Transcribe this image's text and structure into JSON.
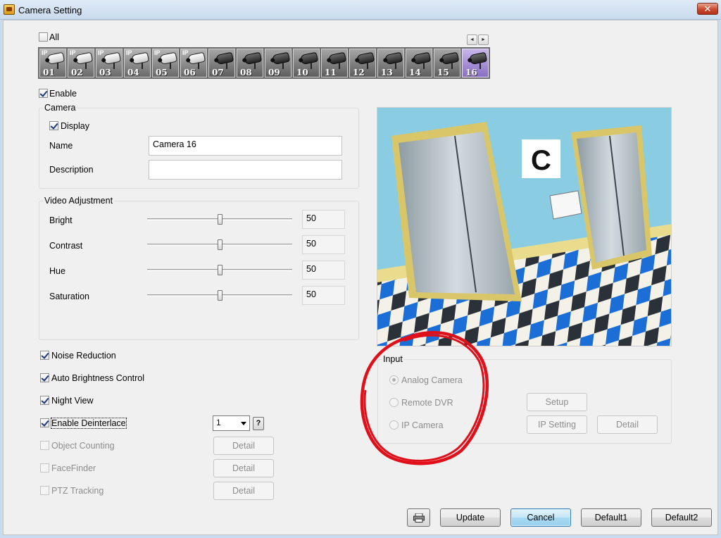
{
  "window": {
    "title": "Camera Setting",
    "close_label": "✕"
  },
  "all_label": "All",
  "cameras": [
    {
      "num": "01",
      "badge": "IP"
    },
    {
      "num": "02",
      "badge": "IP"
    },
    {
      "num": "03",
      "badge": "IP"
    },
    {
      "num": "04",
      "badge": "IP"
    },
    {
      "num": "05",
      "badge": "IP"
    },
    {
      "num": "06",
      "badge": "IP"
    },
    {
      "num": "07",
      "badge": ""
    },
    {
      "num": "08",
      "badge": ""
    },
    {
      "num": "09",
      "badge": ""
    },
    {
      "num": "10",
      "badge": ""
    },
    {
      "num": "11",
      "badge": ""
    },
    {
      "num": "12",
      "badge": ""
    },
    {
      "num": "13",
      "badge": ""
    },
    {
      "num": "14",
      "badge": ""
    },
    {
      "num": "15",
      "badge": ""
    },
    {
      "num": "16",
      "badge": ""
    }
  ],
  "selected_camera": "16",
  "scroll_left": "◄",
  "scroll_right": "►",
  "enable_label": "Enable",
  "camera_group": {
    "title": "Camera",
    "display_label": "Display",
    "name_label": "Name",
    "name_value": "Camera 16",
    "description_label": "Description",
    "description_value": ""
  },
  "video_adjustment": {
    "title": "Video Adjustment",
    "sliders": [
      {
        "label": "Bright",
        "value": "50"
      },
      {
        "label": "Contrast",
        "value": "50"
      },
      {
        "label": "Hue",
        "value": "50"
      },
      {
        "label": "Saturation",
        "value": "50"
      }
    ]
  },
  "options": {
    "noise_reduction": "Noise Reduction",
    "auto_brightness": "Auto Brightness Control",
    "night_view": "Night View",
    "enable_deinterlace": "Enable Deinterlace",
    "deinterlace_value": "1",
    "help_label": "?",
    "object_counting": "Object Counting",
    "facefinder": "FaceFinder",
    "ptz_tracking": "PTZ Tracking",
    "detail_label": "Detail"
  },
  "input_group": {
    "title": "Input",
    "analog_camera": "Analog Camera",
    "remote_dvr": "Remote DVR",
    "ip_camera": "IP Camera",
    "setup_label": "Setup",
    "ip_setting_label": "IP Setting",
    "detail_label": "Detail"
  },
  "footer": {
    "update_label": "Update",
    "cancel_label": "Cancel",
    "default1_label": "Default1",
    "default2_label": "Default2"
  }
}
